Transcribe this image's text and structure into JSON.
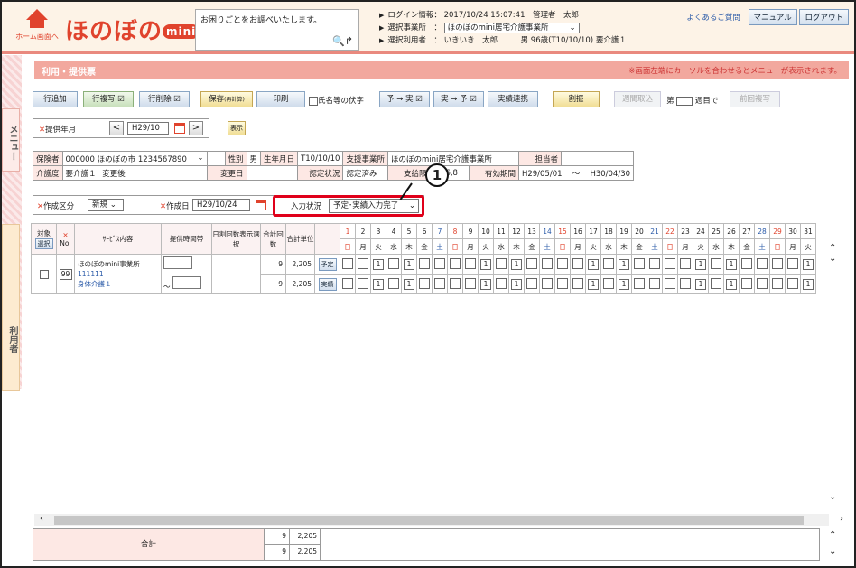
{
  "header": {
    "home_label": "ホーム画面へ",
    "logo_text": "ほのぼの",
    "logo_mini": "mini",
    "help_placeholder": "お困りごとをお調べいたします。",
    "login_label": "ログイン情報：",
    "login_value": "2017/10/24 15:07:41　管理者　太郎",
    "office_label": "選択事業所　：",
    "office_value": "ほのぼのmini居宅介護事業所",
    "user_label": "選択利用者　：",
    "user_value": "いきいき　太郎　　　男 96歳(T10/10/10) 要介護１",
    "faq": "よくあるご質問",
    "manual": "マニュアル",
    "logout": "ログアウト"
  },
  "side": {
    "menu_tab": "メニュー",
    "user_tab": "利用者"
  },
  "title": {
    "text": "利用・提供票",
    "note": "※画面左端にカーソルを合わせるとメニューが表示されます。"
  },
  "toolbar": {
    "add_row": "行追加",
    "copy_row": "行複写",
    "del_row": "行削除",
    "save": "保存",
    "save_sub": "(再計算)",
    "print": "印刷",
    "mask_name": "氏名等の伏字",
    "plan_to_actual": "予 → 実",
    "actual_to_plan": "実 → 予",
    "actual_link": "実績連携",
    "split": "割振",
    "weekly_take": "週間取込",
    "week_prefix": "第",
    "week_suffix": "週目で",
    "prev_copy": "前回複写"
  },
  "month": {
    "label": "提供年月",
    "value": "H29/10",
    "show": "表示"
  },
  "info": {
    "insurer_label": "保険者",
    "insurer_value": "000000 ほのぼの市 1234567890",
    "sex_label": "性別",
    "sex_value": "男",
    "birth_label": "生年月日",
    "birth_value": "T10/10/10",
    "support_label": "支援事業所",
    "support_value": "ほのぼのmini居宅介護事業所",
    "manager_label": "担当者",
    "manager_value": "",
    "care_label": "介護度",
    "care_value": "要介護１",
    "after_label": "変更後",
    "after_value": "",
    "change_date_label": "変更日",
    "change_date_value": "",
    "cert_label": "認定状況",
    "cert_value": "認定済み",
    "limit_label": "支給限度",
    "limit_value": "16,8",
    "valid_label": "有効期間",
    "valid_from": "H29/05/01",
    "valid_sep": "～",
    "valid_to": "H30/04/30"
  },
  "create": {
    "type_label": "作成区分",
    "type_value": "新規",
    "date_label": "作成日",
    "date_value": "H29/10/24",
    "status_label": "入力状況",
    "status_value": "予定･実績入力完了"
  },
  "callout": "1",
  "schedule": {
    "col_target": "対象",
    "col_select": "選択",
    "col_no_mark": "✕",
    "col_no": "No.",
    "col_service": "ｻｰﾋﾞｽ内容",
    "col_time": "提供時間帯",
    "col_daily": "日割回数表示選択",
    "col_total": "合計回数",
    "col_unit": "合計単位",
    "days": [
      "1",
      "2",
      "3",
      "4",
      "5",
      "6",
      "7",
      "8",
      "9",
      "10",
      "11",
      "12",
      "13",
      "14",
      "15",
      "16",
      "17",
      "18",
      "19",
      "20",
      "21",
      "22",
      "23",
      "24",
      "25",
      "26",
      "27",
      "28",
      "29",
      "30",
      "31"
    ],
    "weekdays": [
      "日",
      "月",
      "火",
      "水",
      "木",
      "金",
      "土",
      "日",
      "月",
      "火",
      "水",
      "木",
      "金",
      "土",
      "日",
      "月",
      "火",
      "水",
      "木",
      "金",
      "土",
      "日",
      "月",
      "火",
      "水",
      "木",
      "金",
      "土",
      "日",
      "月",
      "火"
    ],
    "row": {
      "no": "99",
      "office": "ほのぼのmini事業所",
      "code": "111111",
      "service": "身体介護１",
      "time_sep": "～",
      "plan_count": "9",
      "plan_units": "2,205",
      "plan_label": "予定",
      "actual_count": "9",
      "actual_units": "2,205",
      "actual_label": "実績",
      "plan_days": [
        "",
        "",
        "1",
        "",
        "1",
        "",
        "",
        "",
        "",
        "1",
        "",
        "1",
        "",
        "",
        "",
        "",
        "1",
        "",
        "1",
        "",
        "",
        "",
        "",
        "1",
        "",
        "1",
        "",
        "",
        "",
        "",
        "1"
      ],
      "actual_days": [
        "",
        "",
        "1",
        "",
        "1",
        "",
        "",
        "",
        "",
        "1",
        "",
        "1",
        "",
        "",
        "",
        "",
        "1",
        "",
        "1",
        "",
        "",
        "",
        "",
        "1",
        "",
        "1",
        "",
        "",
        "",
        "",
        "1"
      ]
    }
  },
  "footer": {
    "label": "合計",
    "count1": "9",
    "units1": "2,205",
    "count2": "9",
    "units2": "2,205"
  }
}
